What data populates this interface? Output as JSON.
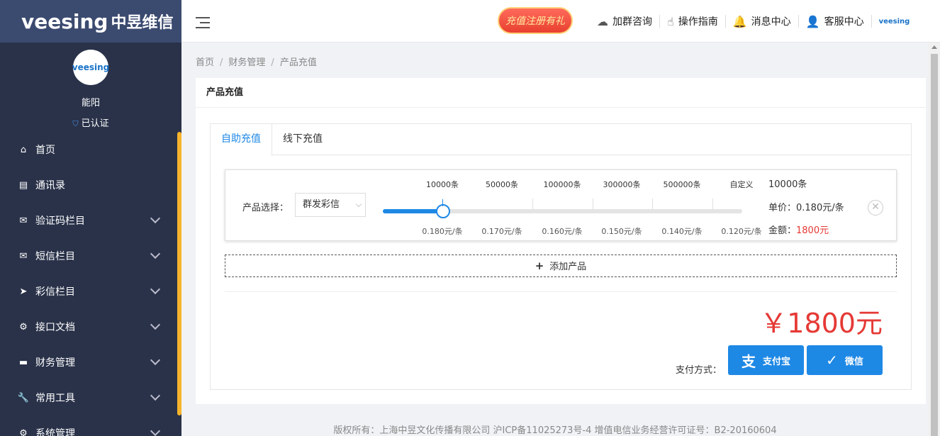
{
  "sidebar": {
    "logo_text": "veesing",
    "logo_cn": "中昱维信",
    "avatar_text": "veesing",
    "username": "能阳",
    "verified": "已认证",
    "menu": [
      {
        "label": "首页",
        "icon": "⌂"
      },
      {
        "label": "通讯录",
        "icon": "▤"
      },
      {
        "label": "验证码栏目",
        "icon": "✉"
      },
      {
        "label": "短信栏目",
        "icon": "✉"
      },
      {
        "label": "彩信栏目",
        "icon": "➤"
      },
      {
        "label": "接口文档",
        "icon": "⚙"
      },
      {
        "label": "财务管理",
        "icon": "▬"
      },
      {
        "label": "常用工具",
        "icon": "🔧"
      },
      {
        "label": "系统管理",
        "icon": "⚙"
      }
    ]
  },
  "header": {
    "promo": "充值注册有礼",
    "nav": [
      {
        "label": "加群咨询",
        "icon": "☁"
      },
      {
        "label": "操作指南",
        "icon": "☝"
      },
      {
        "label": "消息中心",
        "icon": "🔔"
      },
      {
        "label": "客服中心",
        "icon": "👤"
      }
    ],
    "mini_logo": "veesing"
  },
  "breadcrumb": [
    "首页",
    "财务管理",
    "产品充值"
  ],
  "card": {
    "title": "产品充值",
    "tabs": [
      "自助充值",
      "线下充值"
    ],
    "product": {
      "label": "产品选择：",
      "selected": "群发彩信",
      "tiers": [
        {
          "qty": "10000条",
          "price": "0.180元/条"
        },
        {
          "qty": "50000条",
          "price": "0.170元/条"
        },
        {
          "qty": "100000条",
          "price": "0.160元/条"
        },
        {
          "qty": "300000条",
          "price": "0.150元/条"
        },
        {
          "qty": "500000条",
          "price": "0.140元/条"
        },
        {
          "qty": "自定义",
          "price": "0.120元/条"
        }
      ],
      "slider_level": 0.168,
      "qty_value": "10000条",
      "unit_price": "单价：0.180元/条",
      "amount_label": "金额：",
      "amount_value": "1800元"
    },
    "add_product": "添加产品",
    "total": "￥1800元",
    "pay_label": "支付方式：",
    "pay_alipay": "支付宝",
    "pay_wechat": "微信"
  },
  "footer": "版权所有：上海中昱文化传播有限公司 沪ICP备11025273号-4 增值电信业务经营许可证号：B2-20160604",
  "colors": {
    "accent": "#1e88e5",
    "sidebar": "#293249",
    "price_red": "#e53935",
    "sidebar_scroll": "#f7b32b"
  }
}
